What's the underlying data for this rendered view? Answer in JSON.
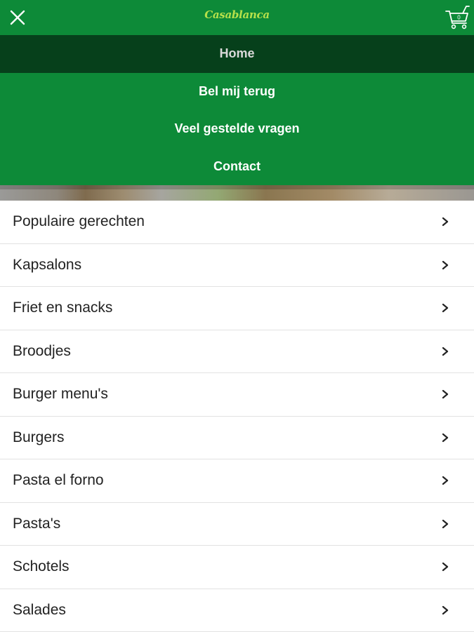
{
  "header": {
    "brand": "Casablanca",
    "close_icon": "close-icon",
    "cart_icon": "cart-icon",
    "cart_count": "0"
  },
  "nav_menu": [
    {
      "label": "Home",
      "active": true
    },
    {
      "label": "Bel mij terug",
      "active": false
    },
    {
      "label": "Veel gestelde vragen",
      "active": false
    },
    {
      "label": "Contact",
      "active": false
    }
  ],
  "categories": [
    {
      "label": "Populaire gerechten"
    },
    {
      "label": "Kapsalons"
    },
    {
      "label": "Friet en snacks"
    },
    {
      "label": "Broodjes"
    },
    {
      "label": "Burger menu's"
    },
    {
      "label": "Burgers"
    },
    {
      "label": "Pasta el forno"
    },
    {
      "label": "Pasta's"
    },
    {
      "label": "Schotels"
    },
    {
      "label": "Salades"
    }
  ],
  "colors": {
    "brand_green": "#0d8a38",
    "active_menu": "#06401b",
    "logo_text": "#b6e04a"
  }
}
